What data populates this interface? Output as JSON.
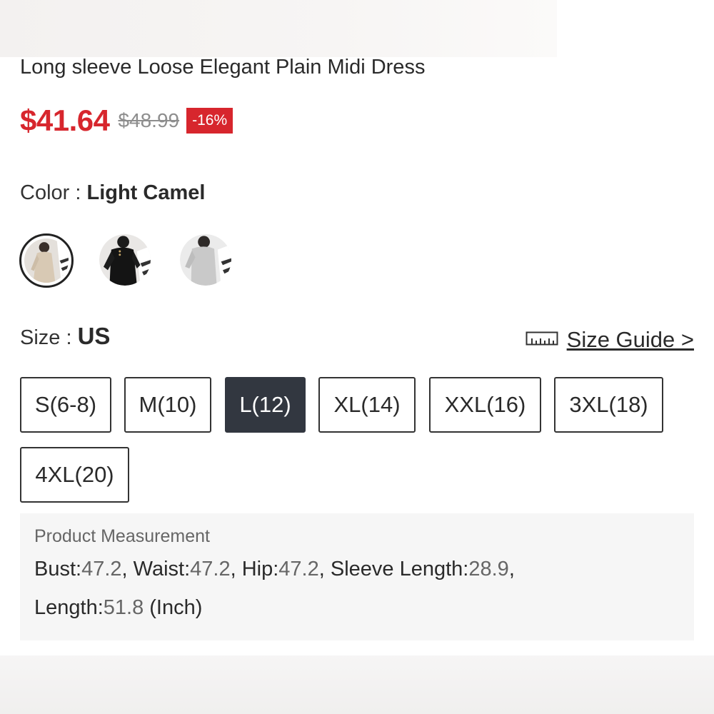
{
  "product": {
    "title": "Long sleeve Loose Elegant Plain Midi Dress",
    "price_sale": "$41.64",
    "price_original": "$48.99",
    "discount": "-16%"
  },
  "color": {
    "label": "Color : ",
    "selected": "Light Camel",
    "swatches": [
      {
        "name": "Light Camel",
        "selected": true
      },
      {
        "name": "Black",
        "selected": false
      },
      {
        "name": "Light Grey",
        "selected": false
      }
    ]
  },
  "size": {
    "label": "Size : ",
    "system": "US",
    "guide_label": "Size Guide >",
    "options": [
      {
        "label": "S(6-8)",
        "selected": false
      },
      {
        "label": "M(10)",
        "selected": false
      },
      {
        "label": "L(12)",
        "selected": true
      },
      {
        "label": "XL(14)",
        "selected": false
      },
      {
        "label": "XXL(16)",
        "selected": false
      },
      {
        "label": "3XL(18)",
        "selected": false
      },
      {
        "label": "4XL(20)",
        "selected": false
      }
    ]
  },
  "measurement": {
    "title": "Product Measurement",
    "bust_label": "Bust:",
    "bust": "47.2",
    "waist_label": ", Waist:",
    "waist": "47.2",
    "hip_label": ", Hip:",
    "hip": "47.2",
    "sleeve_label": ", Sleeve Length:",
    "sleeve": "28.9",
    "sleeve_tail": ",",
    "length_label": "Length:",
    "length": "51.8",
    "unit": " (Inch)"
  },
  "colors": {
    "sale_red": "#d7262d",
    "selected_size_bg": "#323740"
  }
}
